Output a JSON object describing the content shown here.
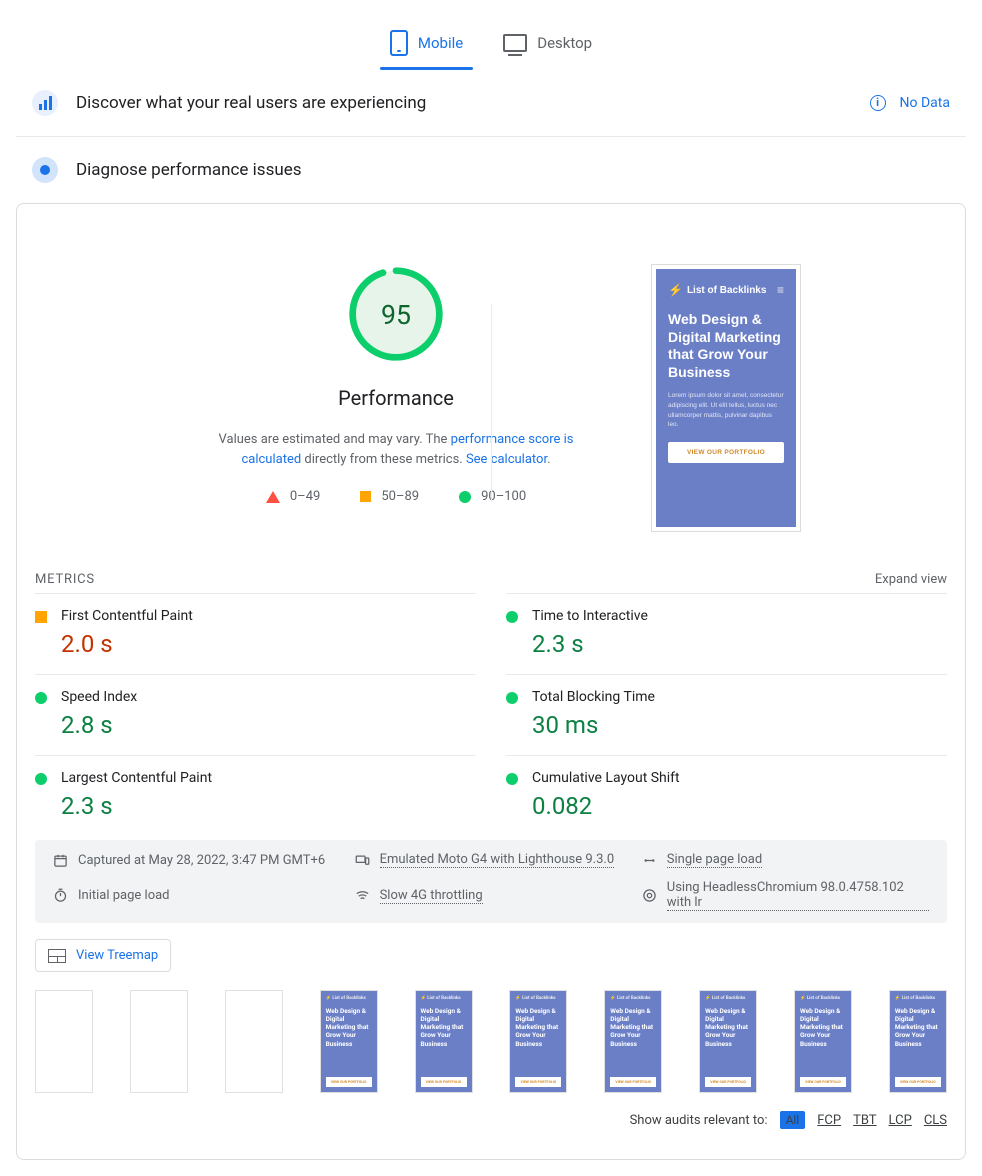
{
  "tabs": {
    "mobile": "Mobile",
    "desktop": "Desktop"
  },
  "crux": {
    "title": "Discover what your real users are experiencing",
    "nodata": "No Data"
  },
  "diag": {
    "title": "Diagnose performance issues"
  },
  "score": {
    "value": "95",
    "label": "Performance",
    "desc_prefix": "Values are estimated and may vary. The ",
    "desc_link1": "performance score is calculated",
    "desc_mid": " directly from these metrics. ",
    "desc_link2": "See calculator",
    "desc_suffix": "."
  },
  "legend": {
    "fail": "0–49",
    "mid": "50–89",
    "pass": "90–100"
  },
  "preview": {
    "brand": "List of Backlinks",
    "title": "Web Design & Digital Marketing that Grow Your Business",
    "body": "Lorem ipsum dolor sit amet, consectetur adipiscing elit. Ut elit tellus, luctus nec ullamcorper mattis, pulvinar dapibus leo.",
    "button": "VIEW OUR PORTFOLIO"
  },
  "metrics_header": {
    "title": "METRICS",
    "expand": "Expand view"
  },
  "metrics": {
    "fcp": {
      "name": "First Contentful Paint",
      "value": "2.0 s",
      "color": "orange",
      "shape": "square"
    },
    "tti": {
      "name": "Time to Interactive",
      "value": "2.3 s",
      "color": "green",
      "shape": "circle"
    },
    "si": {
      "name": "Speed Index",
      "value": "2.8 s",
      "color": "green",
      "shape": "circle"
    },
    "tbt": {
      "name": "Total Blocking Time",
      "value": "30 ms",
      "color": "green",
      "shape": "circle"
    },
    "lcp": {
      "name": "Largest Contentful Paint",
      "value": "2.3 s",
      "color": "green",
      "shape": "circle"
    },
    "cls": {
      "name": "Cumulative Layout Shift",
      "value": "0.082",
      "color": "green",
      "shape": "circle"
    }
  },
  "info": {
    "captured": "Captured at May 28, 2022, 3:47 PM GMT+6",
    "emulated": "Emulated Moto G4 with Lighthouse 9.3.0",
    "load": "Single page load",
    "initial": "Initial page load",
    "throttle": "Slow 4G throttling",
    "browser": "Using HeadlessChromium 98.0.4758.102 with lr"
  },
  "treemap": "View Treemap",
  "audits": {
    "label": "Show audits relevant to:",
    "all": "All",
    "fcp": "FCP",
    "tbt": "TBT",
    "lcp": "LCP",
    "cls": "CLS"
  },
  "thumb": {
    "header": "⚡ List of Backlinks",
    "title": "Web Design & Digital Marketing that Grow Your Business",
    "button": "VIEW OUR PORTFOLIO"
  }
}
